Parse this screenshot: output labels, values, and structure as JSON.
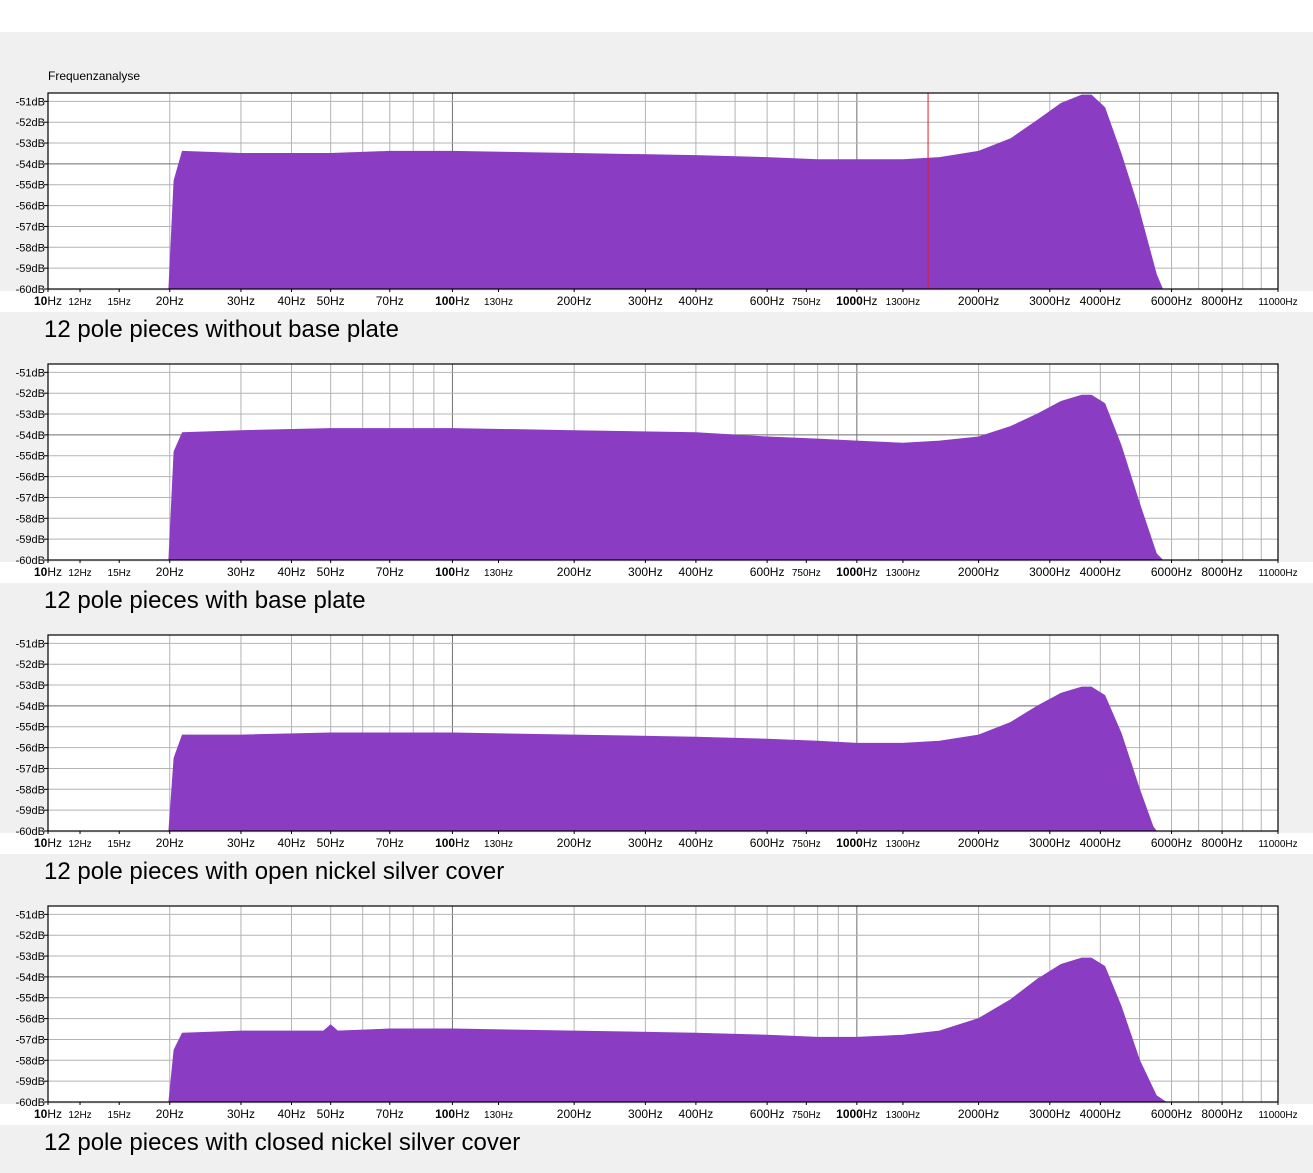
{
  "window_title": "Frequenzanalyse",
  "chart_data": [
    {
      "type": "area",
      "caption": "12 pole pieces without base plate",
      "xscale": "log",
      "xlim": [
        10,
        11000
      ],
      "ylim": [
        -60,
        -50.6
      ],
      "xunit": "Hz",
      "yunit": "dB",
      "grid": true,
      "cursor_hz": 1500,
      "x": [
        19.9,
        20.5,
        21.5,
        30,
        50,
        70,
        100,
        200,
        400,
        600,
        800,
        1000,
        1300,
        1600,
        2000,
        2400,
        2800,
        3200,
        3600,
        3800,
        4100,
        4500,
        5000,
        5500,
        5700
      ],
      "y": [
        -60,
        -54.8,
        -53.4,
        -53.5,
        -53.5,
        -53.4,
        -53.4,
        -53.5,
        -53.6,
        -53.7,
        -53.8,
        -53.8,
        -53.8,
        -53.7,
        -53.4,
        -52.8,
        -51.9,
        -51.1,
        -50.7,
        -50.7,
        -51.3,
        -53.5,
        -56.3,
        -59.3,
        -60
      ]
    },
    {
      "type": "area",
      "caption": "12 pole pieces with base plate",
      "xscale": "log",
      "xlim": [
        10,
        11000
      ],
      "ylim": [
        -60,
        -50.6
      ],
      "xunit": "Hz",
      "yunit": "dB",
      "grid": true,
      "x": [
        19.9,
        20.5,
        21.5,
        30,
        50,
        70,
        100,
        200,
        400,
        600,
        800,
        1000,
        1300,
        1600,
        2000,
        2400,
        2800,
        3200,
        3600,
        3800,
        4100,
        4500,
        5000,
        5500,
        5700
      ],
      "y": [
        -60,
        -54.8,
        -53.9,
        -53.8,
        -53.7,
        -53.7,
        -53.7,
        -53.8,
        -53.9,
        -54.1,
        -54.2,
        -54.3,
        -54.4,
        -54.3,
        -54.1,
        -53.6,
        -53,
        -52.4,
        -52.1,
        -52.1,
        -52.5,
        -54.5,
        -57.3,
        -59.7,
        -60
      ]
    },
    {
      "type": "area",
      "caption": "12 pole pieces with open nickel silver cover",
      "xscale": "log",
      "xlim": [
        10,
        11000
      ],
      "ylim": [
        -60,
        -50.6
      ],
      "xunit": "Hz",
      "yunit": "dB",
      "grid": true,
      "x": [
        19.9,
        20.5,
        21.5,
        30,
        50,
        70,
        100,
        200,
        400,
        600,
        800,
        1000,
        1300,
        1600,
        2000,
        2400,
        2800,
        3200,
        3600,
        3800,
        4100,
        4500,
        5000,
        5400,
        5500
      ],
      "y": [
        -60,
        -56.5,
        -55.4,
        -55.4,
        -55.3,
        -55.3,
        -55.3,
        -55.4,
        -55.5,
        -55.6,
        -55.7,
        -55.8,
        -55.8,
        -55.7,
        -55.4,
        -54.8,
        -54,
        -53.4,
        -53.1,
        -53.1,
        -53.5,
        -55.3,
        -58,
        -59.8,
        -60
      ]
    },
    {
      "type": "area",
      "caption": "12 pole pieces with closed nickel silver cover",
      "xscale": "log",
      "xlim": [
        10,
        11000
      ],
      "ylim": [
        -60,
        -50.6
      ],
      "xunit": "Hz",
      "yunit": "dB",
      "grid": true,
      "x": [
        19.9,
        20.5,
        21.5,
        30,
        48,
        50,
        52,
        70,
        100,
        200,
        400,
        600,
        800,
        1000,
        1300,
        1600,
        2000,
        2400,
        2800,
        3200,
        3600,
        3800,
        4100,
        4500,
        5000,
        5500,
        5800
      ],
      "y": [
        -60,
        -57.5,
        -56.7,
        -56.6,
        -56.6,
        -56.3,
        -56.6,
        -56.5,
        -56.5,
        -56.6,
        -56.7,
        -56.8,
        -56.9,
        -56.9,
        -56.8,
        -56.6,
        -56,
        -55.1,
        -54.1,
        -53.4,
        -53.1,
        -53.1,
        -53.5,
        -55.4,
        -58,
        -59.7,
        -60
      ]
    }
  ],
  "axes": {
    "y_ticks": [
      {
        "v": -51,
        "label": "-51dB"
      },
      {
        "v": -52,
        "label": "-52dB"
      },
      {
        "v": -53,
        "label": "-53dB"
      },
      {
        "v": -54,
        "label": "-54dB"
      },
      {
        "v": -55,
        "label": "-55dB"
      },
      {
        "v": -56,
        "label": "-56dB"
      },
      {
        "v": -57,
        "label": "-57dB"
      },
      {
        "v": -58,
        "label": "-58dB"
      },
      {
        "v": -59,
        "label": "-59dB"
      },
      {
        "v": -60,
        "label": "-60dB"
      }
    ],
    "x_ticks": [
      {
        "v": 10,
        "num": "10",
        "unit": "Hz",
        "style": "bold"
      },
      {
        "v": 12,
        "num": "12",
        "unit": "Hz",
        "style": "small"
      },
      {
        "v": 15,
        "num": "15",
        "unit": "Hz",
        "style": "small"
      },
      {
        "v": 20,
        "num": "20",
        "unit": "Hz",
        "style": "normal"
      },
      {
        "v": 30,
        "num": "30",
        "unit": "Hz",
        "style": "normal"
      },
      {
        "v": 40,
        "num": "40",
        "unit": "Hz",
        "style": "normal"
      },
      {
        "v": 50,
        "num": "50",
        "unit": "Hz",
        "style": "normal"
      },
      {
        "v": 70,
        "num": "70",
        "unit": "Hz",
        "style": "normal"
      },
      {
        "v": 100,
        "num": "100",
        "unit": "Hz",
        "style": "bold"
      },
      {
        "v": 130,
        "num": "130",
        "unit": "Hz",
        "style": "small"
      },
      {
        "v": 200,
        "num": "200",
        "unit": "Hz",
        "style": "normal"
      },
      {
        "v": 300,
        "num": "300",
        "unit": "Hz",
        "style": "normal"
      },
      {
        "v": 400,
        "num": "400",
        "unit": "Hz",
        "style": "normal"
      },
      {
        "v": 600,
        "num": "600",
        "unit": "Hz",
        "style": "normal"
      },
      {
        "v": 750,
        "num": "750",
        "unit": "Hz",
        "style": "small"
      },
      {
        "v": 1000,
        "num": "1000",
        "unit": "Hz",
        "style": "bold"
      },
      {
        "v": 1300,
        "num": "1300",
        "unit": "Hz",
        "style": "small"
      },
      {
        "v": 2000,
        "num": "2000",
        "unit": "Hz",
        "style": "normal"
      },
      {
        "v": 3000,
        "num": "3000",
        "unit": "Hz",
        "style": "normal"
      },
      {
        "v": 4000,
        "num": "4000",
        "unit": "Hz",
        "style": "normal"
      },
      {
        "v": 6000,
        "num": "6000",
        "unit": "Hz",
        "style": "normal"
      },
      {
        "v": 8000,
        "num": "8000",
        "unit": "Hz",
        "style": "normal"
      },
      {
        "v": 11000,
        "num": "11000",
        "unit": "Hz",
        "style": "small"
      }
    ],
    "grid_values": [
      20,
      30,
      40,
      50,
      60,
      70,
      80,
      90,
      100,
      200,
      300,
      400,
      500,
      600,
      700,
      800,
      900,
      1000,
      2000,
      3000,
      4000,
      5000,
      6000,
      7000,
      8000,
      9000,
      10000
    ]
  },
  "colors": {
    "fill": "#8a3dc2",
    "cursor": "#e02020",
    "grid": "#b4b4b4",
    "major_grid": "#6e6e6e",
    "frame": "#000000"
  }
}
